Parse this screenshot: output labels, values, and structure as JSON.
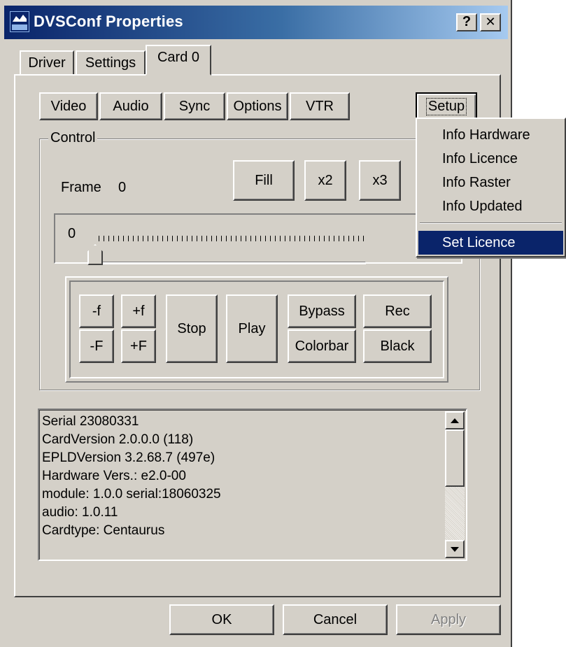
{
  "window": {
    "title": "DVSConf Properties",
    "help_label": "?",
    "close_label": "✕"
  },
  "tabs": [
    {
      "label": "Driver"
    },
    {
      "label": "Settings"
    },
    {
      "label": "Card 0",
      "active": true
    }
  ],
  "subtabs": [
    "Video",
    "Audio",
    "Sync",
    "Options",
    "VTR"
  ],
  "setup_label": "Setup",
  "control": {
    "legend": "Control",
    "frame_label": "Frame",
    "frame_value": "0",
    "zoom_buttons": [
      "Fill",
      "x2",
      "x3"
    ],
    "slider_value_text": "0"
  },
  "transport": {
    "step_back_small": "-f",
    "step_fwd_small": "+f",
    "step_back_large": "-F",
    "step_fwd_large": "+F",
    "stop": "Stop",
    "play": "Play",
    "bypass": "Bypass",
    "rec": "Rec",
    "colorbar": "Colorbar",
    "black": "Black"
  },
  "info_lines": [
    "Serial 23080331",
    "CardVersion 2.0.0.0 (118)",
    "EPLDVersion 3.2.68.7 (497e)",
    "Hardware Vers.: e2.0-00",
    "module: 1.0.0  serial:18060325",
    "audio: 1.0.11",
    "Cardtype: Centaurus"
  ],
  "setup_menu": {
    "items": [
      "Info Hardware",
      "Info Licence",
      "Info Raster",
      "Info Updated"
    ],
    "highlighted_item": "Set Licence"
  },
  "footer": {
    "ok": "OK",
    "cancel": "Cancel",
    "apply": "Apply"
  },
  "colors": {
    "face": "#d4d0c8",
    "title_active": "#0a246a",
    "highlight": "#0a246a"
  }
}
